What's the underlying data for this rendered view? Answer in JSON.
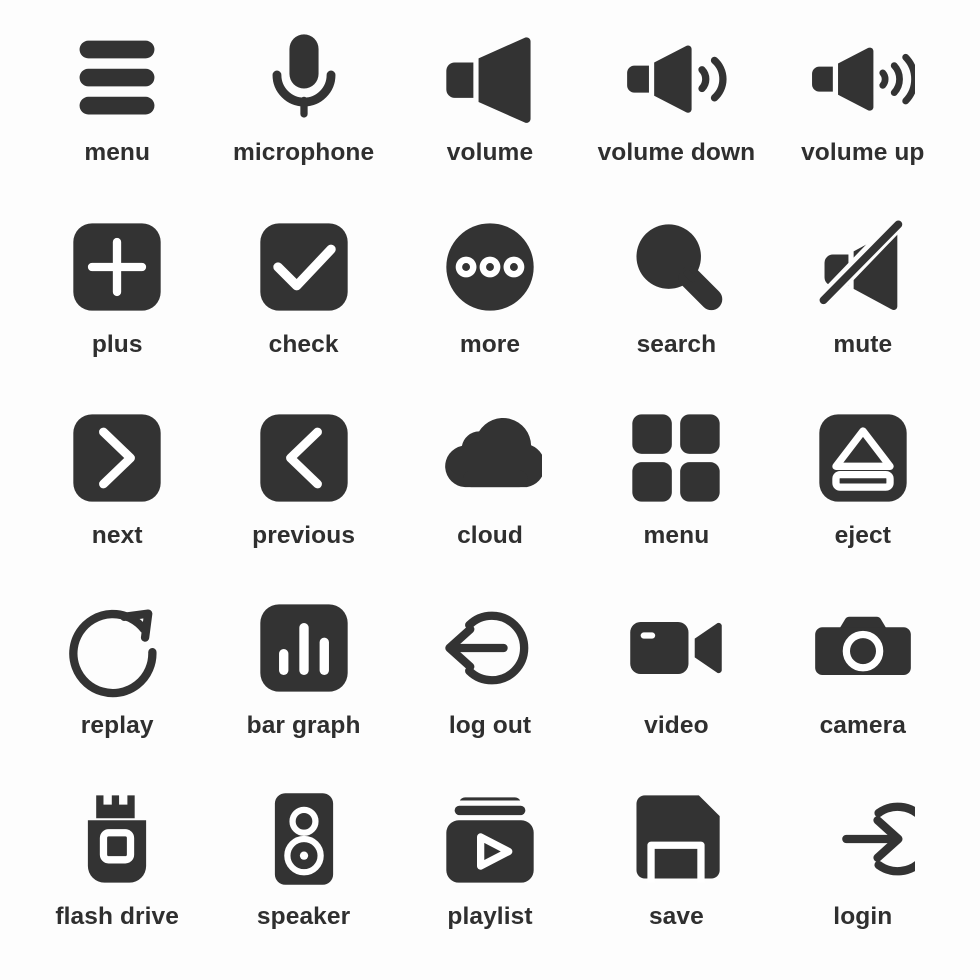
{
  "sheet": {
    "title": "Icon Set",
    "background_color": "#fdfdfd",
    "icon_color": "#333333",
    "label_color": "#2f2f2f",
    "knockout_color": "#ffffff",
    "columns": 5,
    "rows": 5,
    "icon_count": 25
  },
  "icons": [
    {
      "id": "menu-bars",
      "label": "menu",
      "glyph": "menu-bars-icon"
    },
    {
      "id": "microphone",
      "label": "microphone",
      "glyph": "microphone-icon"
    },
    {
      "id": "volume",
      "label": "volume",
      "glyph": "volume-icon"
    },
    {
      "id": "volume-down",
      "label": "volume down",
      "glyph": "volume-down-icon"
    },
    {
      "id": "volume-up",
      "label": "volume up",
      "glyph": "volume-up-icon"
    },
    {
      "id": "plus",
      "label": "plus",
      "glyph": "plus-icon"
    },
    {
      "id": "check",
      "label": "check",
      "glyph": "check-icon"
    },
    {
      "id": "more",
      "label": "more",
      "glyph": "more-icon"
    },
    {
      "id": "search",
      "label": "search",
      "glyph": "search-icon"
    },
    {
      "id": "mute",
      "label": "mute",
      "glyph": "mute-icon"
    },
    {
      "id": "next",
      "label": "next",
      "glyph": "chevron-right-icon"
    },
    {
      "id": "previous",
      "label": "previous",
      "glyph": "chevron-left-icon"
    },
    {
      "id": "cloud",
      "label": "cloud",
      "glyph": "cloud-icon"
    },
    {
      "id": "menu-grid",
      "label": "menu",
      "glyph": "menu-grid-icon"
    },
    {
      "id": "eject",
      "label": "eject",
      "glyph": "eject-icon"
    },
    {
      "id": "replay",
      "label": "replay",
      "glyph": "replay-icon"
    },
    {
      "id": "bar-graph",
      "label": "bar graph",
      "glyph": "bar-graph-icon"
    },
    {
      "id": "log-out",
      "label": "log out",
      "glyph": "log-out-icon"
    },
    {
      "id": "video",
      "label": "video",
      "glyph": "video-camera-icon"
    },
    {
      "id": "camera",
      "label": "camera",
      "glyph": "camera-icon"
    },
    {
      "id": "flash-drive",
      "label": "flash drive",
      "glyph": "flash-drive-icon"
    },
    {
      "id": "speaker",
      "label": "speaker",
      "glyph": "speaker-icon"
    },
    {
      "id": "playlist",
      "label": "playlist",
      "glyph": "playlist-icon"
    },
    {
      "id": "save",
      "label": "save",
      "glyph": "floppy-disk-icon"
    },
    {
      "id": "login",
      "label": "login",
      "glyph": "login-icon"
    }
  ]
}
